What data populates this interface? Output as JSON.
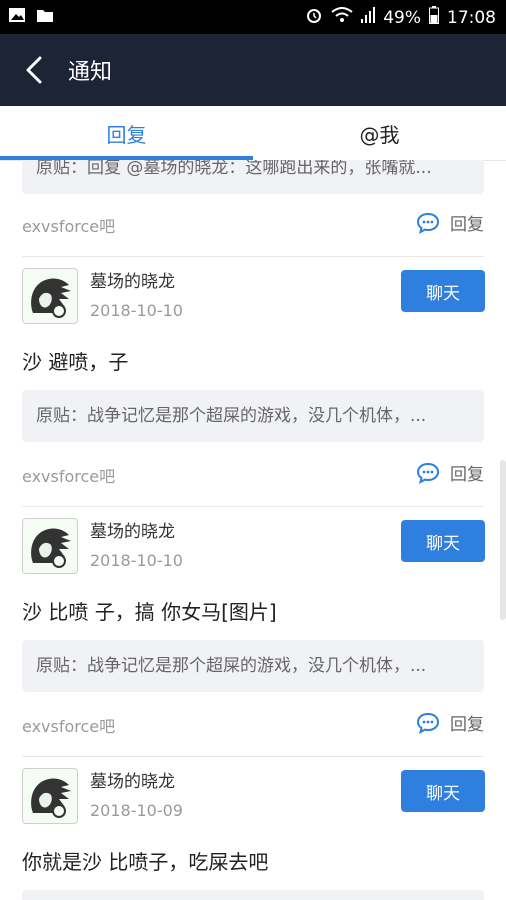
{
  "status_bar": {
    "battery": "49%",
    "time": "17:08"
  },
  "header": {
    "title": "通知"
  },
  "tabs": [
    {
      "label": "回复"
    },
    {
      "label": "@我"
    }
  ],
  "notifications": [
    {
      "quote": "原贴：回复 @墓场的晓龙：这哪跑出来的，张嘴就...",
      "source": "exvsforce吧",
      "reply_label": "回复"
    },
    {
      "username": "墓场的晓龙",
      "date": "2018-10-10",
      "chat_label": "聊天",
      "content": "沙 避喷，子",
      "quote": "原贴：战争记忆是那个超屎的游戏，没几个机体，...",
      "source": "exvsforce吧",
      "reply_label": "回复"
    },
    {
      "username": "墓场的晓龙",
      "date": "2018-10-10",
      "chat_label": "聊天",
      "content": "沙 比喷 子，搞 你女马[图片]",
      "quote": "原贴：战争记忆是那个超屎的游戏，没几个机体，...",
      "source": "exvsforce吧",
      "reply_label": "回复"
    },
    {
      "username": "墓场的晓龙",
      "date": "2018-10-09",
      "chat_label": "聊天",
      "content": "你就是沙 比喷子，吃屎去吧"
    }
  ]
}
